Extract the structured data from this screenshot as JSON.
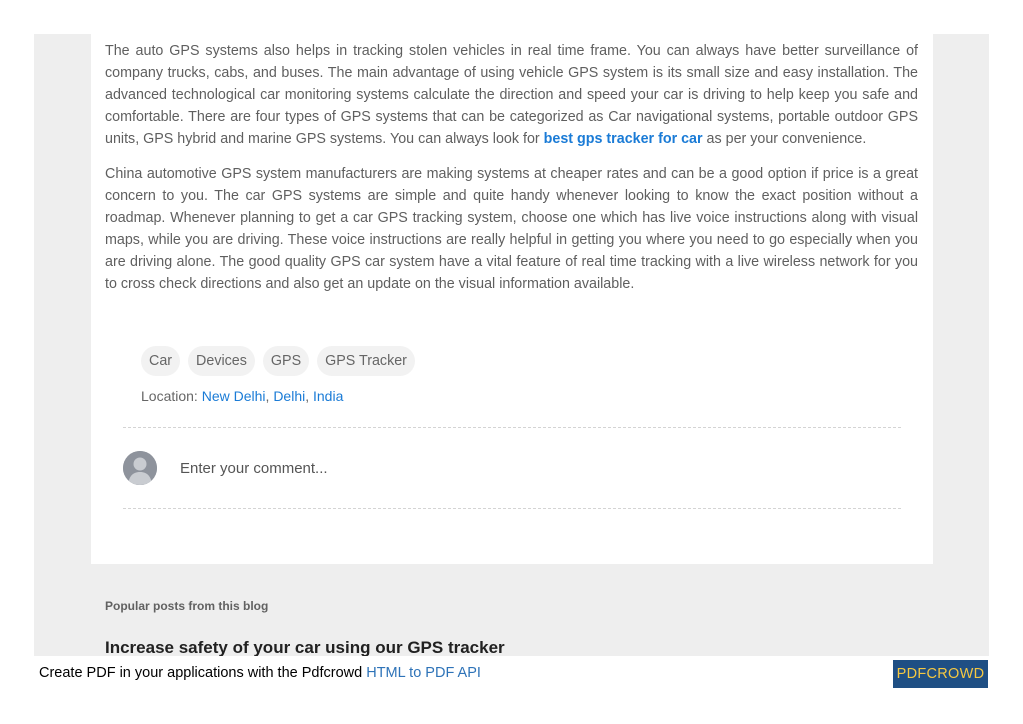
{
  "article": {
    "para1_text": "The auto GPS systems also helps in tracking stolen vehicles in real time frame. You can always have better surveillance of company trucks, cabs, and buses. The main advantage of using vehicle GPS system is its small size and easy installation. The advanced technological car monitoring systems calculate the direction and speed your car is driving to help keep you safe and comfortable. There are four types of GPS systems that can be categorized as Car navigational systems, portable outdoor GPS units, GPS hybrid and marine GPS systems. You can always look for ",
    "para1_link": "best gps tracker for car",
    "para1_end": " as per your convenience.",
    "para2": "China automotive GPS system manufacturers are making systems at cheaper rates and can be a good option if price is a great concern to you. The car GPS systems are simple and quite handy whenever looking to know the exact position without a roadmap. Whenever planning to get a car GPS tracking system, choose one which has live voice instructions along with visual maps, while you are driving. These voice instructions are really helpful in getting you where you need to go especially when you are driving alone. The good quality GPS car system have a vital feature of real time tracking with a live wireless network for you to cross check directions and also get an update on the visual information available."
  },
  "labels": [
    "Car",
    "Devices",
    "GPS",
    "GPS Tracker"
  ],
  "location": {
    "prefix": "Location:",
    "city": "New Delhi",
    "sep1": ",",
    "state": "Delhi",
    "sep2": ",",
    "country": "India"
  },
  "comment": {
    "placeholder": "Enter your comment..."
  },
  "popular": {
    "heading": "Popular posts from this blog",
    "first_title": "Increase safety of your car using our GPS tracker"
  },
  "footer": {
    "text": "Create PDF in your applications with the Pdfcrowd ",
    "link": "HTML to PDF API",
    "badge": "PDFCROWD"
  },
  "colors": {
    "link": "#1a7bd6",
    "badge_bg": "#1f4f84",
    "badge_text": "#f5c842",
    "page_bg": "#eeeeee"
  }
}
